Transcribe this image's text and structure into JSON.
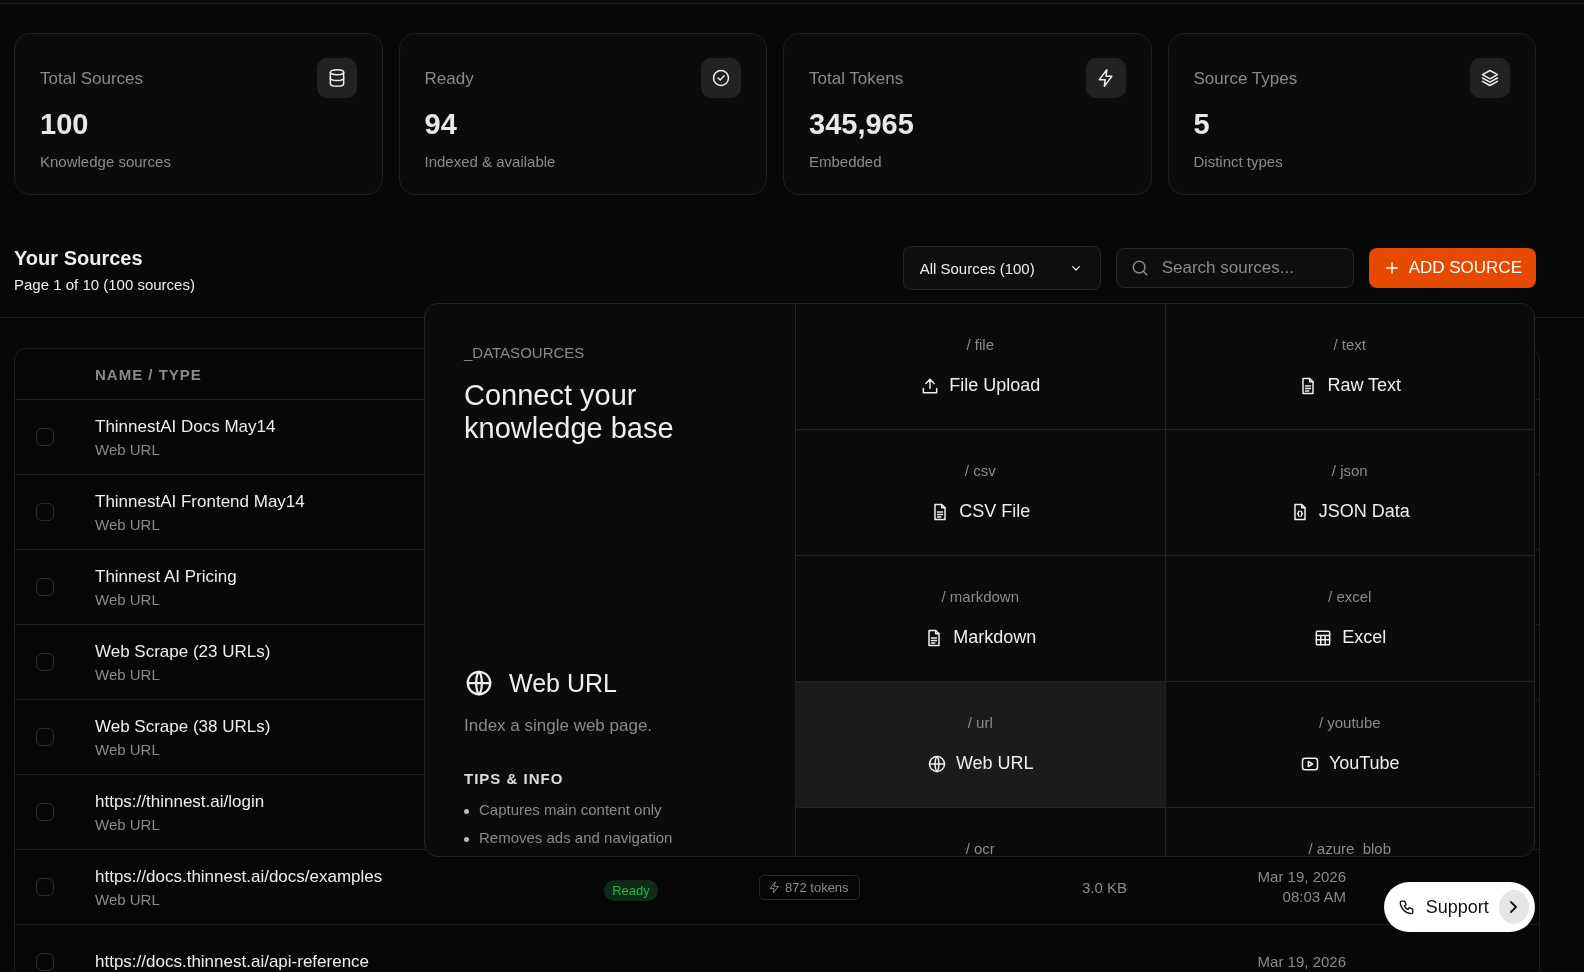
{
  "stats": [
    {
      "label": "Total Sources",
      "value": "100",
      "caption": "Knowledge sources"
    },
    {
      "label": "Ready",
      "value": "94",
      "caption": "Indexed & available"
    },
    {
      "label": "Total Tokens",
      "value": "345,965",
      "caption": "Embedded"
    },
    {
      "label": "Source Types",
      "value": "5",
      "caption": "Distinct types"
    }
  ],
  "sources": {
    "title": "Your Sources",
    "subtitle": "Page 1 of 10 (100 sources)",
    "filter": "All Sources (100)",
    "search": {
      "placeholder": "Search sources..."
    },
    "add_button": "ADD SOURCE"
  },
  "table": {
    "columns": [
      "NAME / TYPE"
    ],
    "rows": [
      {
        "name": "ThinnestAI Docs May14",
        "type": "Web URL",
        "checked": false
      },
      {
        "name": "ThinnestAI Frontend May14",
        "type": "Web URL",
        "checked": false
      },
      {
        "name": "Thinnest AI Pricing",
        "type": "Web URL",
        "checked": false
      },
      {
        "name": "Web Scrape (23 URLs)",
        "type": "Web URL",
        "checked": false
      },
      {
        "name": "Web Scrape (38 URLs)",
        "type": "Web URL",
        "checked": false
      },
      {
        "name": "https://thinnest.ai/login",
        "type": "Web URL",
        "checked": false
      },
      {
        "name": "https://docs.thinnest.ai/docs/examples",
        "type": "Web URL",
        "checked": false,
        "status": "Ready",
        "tokens": "872 tokens",
        "size": "3.0 KB",
        "date": "Mar 19, 2026",
        "time": "08:03 AM"
      },
      {
        "name": "https://docs.thinnest.ai/api-reference",
        "checked": false,
        "date": "Mar 19, 2026"
      }
    ]
  },
  "popover": {
    "eyebrow": "_DATASOURCES",
    "title": "Connect your knowledge base",
    "detail": {
      "title": "Web URL",
      "description": "Index a single web page.",
      "tips_heading": "TIPS & INFO",
      "tips": [
        "Captures main content only",
        "Removes ads and navigation"
      ]
    },
    "tiles": [
      {
        "slug": "/ file",
        "label": "File Upload",
        "selected": false
      },
      {
        "slug": "/ text",
        "label": "Raw Text",
        "selected": false
      },
      {
        "slug": "/ csv",
        "label": "CSV File",
        "selected": false
      },
      {
        "slug": "/ json",
        "label": "JSON Data",
        "selected": false
      },
      {
        "slug": "/ markdown",
        "label": "Markdown",
        "selected": false
      },
      {
        "slug": "/ excel",
        "label": "Excel",
        "selected": false
      },
      {
        "slug": "/ url",
        "label": "Web URL",
        "selected": true
      },
      {
        "slug": "/ youtube",
        "label": "YouTube",
        "selected": false
      },
      {
        "slug": "/ ocr",
        "selected": false
      },
      {
        "slug": "/ azure_blob",
        "selected": false
      }
    ]
  },
  "support": {
    "label": "Support"
  }
}
